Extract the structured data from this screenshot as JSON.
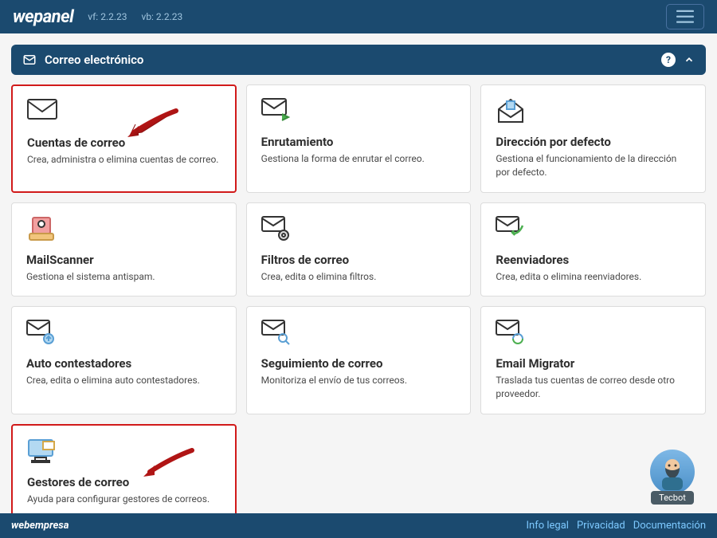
{
  "navbar": {
    "logo": "wepanel",
    "version_vf": "vf: 2.2.23",
    "version_vb": "vb: 2.2.23"
  },
  "section": {
    "title": "Correo electrónico"
  },
  "cards": [
    {
      "title": "Cuentas de correo",
      "desc": "Crea, administra o elimina cuentas de correo.",
      "highlighted": true,
      "icon": "envelope-icon",
      "arrow": true
    },
    {
      "title": "Enrutamiento",
      "desc": "Gestiona la forma de enrutar el correo.",
      "highlighted": false,
      "icon": "envelope-forward-icon"
    },
    {
      "title": "Dirección por defecto",
      "desc": "Gestiona el funcionamiento de la dirección por defecto.",
      "highlighted": false,
      "icon": "envelope-home-icon"
    },
    {
      "title": "MailScanner",
      "desc": "Gestiona el sistema antispam.",
      "highlighted": false,
      "icon": "scanner-icon"
    },
    {
      "title": "Filtros de correo",
      "desc": "Crea, edita o elimina filtros.",
      "highlighted": false,
      "icon": "envelope-gear-icon"
    },
    {
      "title": "Reenviadores",
      "desc": "Crea, edita o elimina reenviadores.",
      "highlighted": false,
      "icon": "envelope-reply-icon"
    },
    {
      "title": "Auto contestadores",
      "desc": "Crea, edita o elimina auto contestadores.",
      "highlighted": false,
      "icon": "envelope-up-icon"
    },
    {
      "title": "Seguimiento de correo",
      "desc": "Monitoriza el envío de tus correos.",
      "highlighted": false,
      "icon": "envelope-search-icon"
    },
    {
      "title": "Email Migrator",
      "desc": "Traslada tus cuentas de correo desde otro proveedor.",
      "highlighted": false,
      "icon": "envelope-sync-icon"
    }
  ],
  "bottom_card": {
    "title": "Gestores de correo",
    "desc": "Ayuda para configurar gestores de correos.",
    "highlighted": true,
    "icon": "monitor-mail-icon",
    "arrow": true
  },
  "footer": {
    "brand": "webempresa",
    "links": [
      "Info legal",
      "Privacidad",
      "Documentación"
    ]
  },
  "tecbot": {
    "label": "Tecbot"
  }
}
